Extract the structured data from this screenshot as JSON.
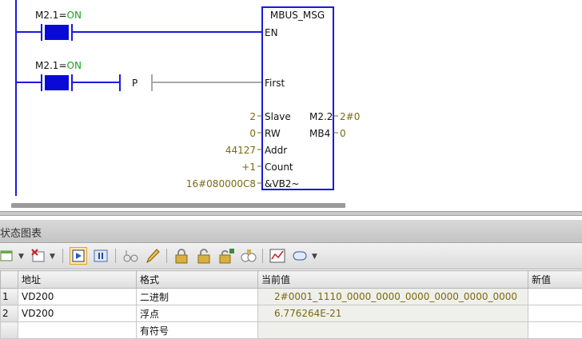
{
  "ladder": {
    "contact1_label": "M2.1=",
    "contact1_state": "ON",
    "contact2_label": "M2.1=",
    "contact2_state": "ON",
    "p_label": "P",
    "block": {
      "name": "MBUS_MSG",
      "pins_in": [
        "EN",
        "First",
        "Slave",
        "RW",
        "Addr",
        "Count",
        "&VB2~"
      ],
      "pins_out": [
        "M2.2",
        "MB4"
      ],
      "in_values": [
        "2",
        "0",
        "44127",
        "+1",
        "16#080000C8"
      ],
      "out_values": [
        "2#0",
        "0"
      ]
    }
  },
  "panel": {
    "title": "状态图表"
  },
  "toolbar": {
    "icons": [
      "add-icon",
      "delete-icon",
      "start-monitor-icon",
      "pause-icon",
      "chart-glasses-icon",
      "pencil-icon",
      "lock-icon",
      "unlock-icon",
      "unlock-all-icon",
      "read-all-icon",
      "trend-chart-icon",
      "tag-icon"
    ]
  },
  "table": {
    "headers": [
      "",
      "地址",
      "格式",
      "当前值",
      "新值"
    ],
    "rows": [
      {
        "num": "1",
        "address": "VD200",
        "format": "二进制",
        "current": "2#0001_1110_0000_0000_0000_0000_0000_0000",
        "new": ""
      },
      {
        "num": "2",
        "address": "VD200",
        "format": "浮点",
        "current": "6.776264E-21",
        "new": ""
      },
      {
        "num": "",
        "address": "",
        "format": "有符号",
        "current": "",
        "new": ""
      }
    ]
  },
  "colors": {
    "ladder_line": "#1a1adc",
    "contact_fill": "#0a0ad8",
    "on_text": "#1aa31a",
    "value_text": "#7a6a10"
  }
}
